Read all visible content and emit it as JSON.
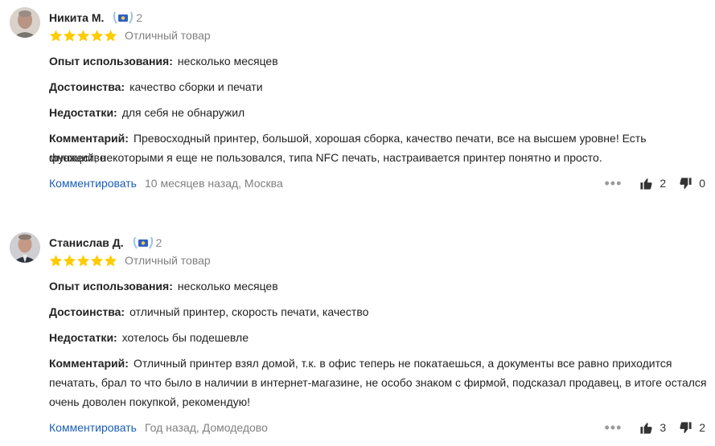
{
  "reviews": [
    {
      "author": "Никита М.",
      "level": "2",
      "stars": 5,
      "verdict": "Отличный товар",
      "experience_label": "Опыт использования:",
      "experience": "несколько месяцев",
      "pros_label": "Достоинства:",
      "pros": "качество сборки и печати",
      "cons_label": "Недостатки:",
      "cons": "для себя не обнаружил",
      "comment_label": "Комментарий:",
      "comment_lines": [
        "Превосходный принтер, большой, хорошая сборка, качество печати, все на высшем уровне! Есть множество",
        "функций, некоторыми я еще не пользовался, типа NFC печать, настраивается принтер понятно и просто."
      ],
      "comment_link": "Комментировать",
      "date_place": "10 месяцев назад, Москва",
      "likes": "2",
      "dislikes": "0"
    },
    {
      "author": "Станислав Д.",
      "level": "2",
      "stars": 5,
      "verdict": "Отличный товар",
      "experience_label": "Опыт использования:",
      "experience": "несколько месяцев",
      "pros_label": "Достоинства:",
      "pros": "отличный принтер, скорость печати, качество",
      "cons_label": "Недостатки:",
      "cons": "хотелось бы подешевле",
      "comment_label": "Комментарий:",
      "comment_lines": [
        "Отличный принтер взял домой, т.к. в офис теперь не покатаешься, а документы все равно приходится",
        "печатать, брал то что было в наличии в интернет-магазине, не особо знаком с фирмой, подсказал продавец, в итоге остался",
        "очень доволен покупкой, рекомендую!"
      ],
      "comment_link": "Комментировать",
      "date_place": "Год назад, Домодедово",
      "likes": "3",
      "dislikes": "2"
    }
  ],
  "colors": {
    "star": "#ffcc00",
    "link": "#1a5fb4",
    "muted": "#808080",
    "badge_blue": "#2f5fc4",
    "laurel": "#9cc3e6"
  },
  "icons": {
    "more": "more-dots-icon",
    "like": "thumb-up-icon",
    "dislike": "thumb-down-icon",
    "badge": "laurel-badge-icon",
    "star": "star-icon"
  }
}
